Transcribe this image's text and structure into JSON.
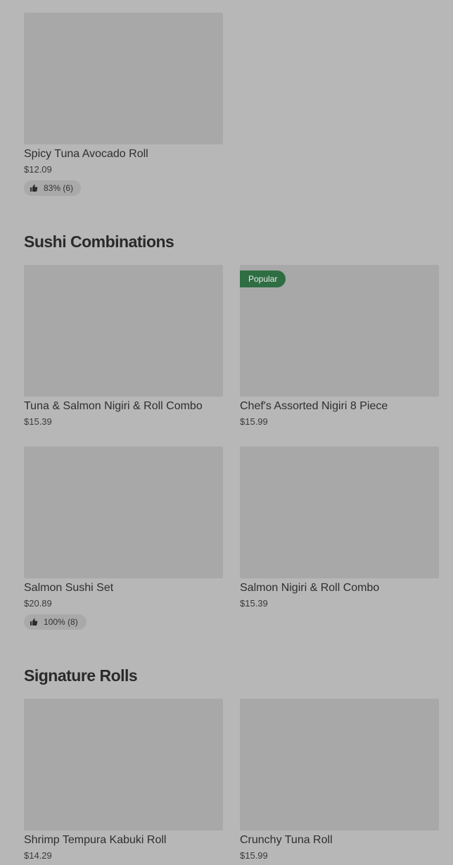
{
  "sections": [
    {
      "items": [
        {
          "name": "Spicy Tuna Avocado Roll",
          "price": "$12.09",
          "rating": "83% (6)"
        }
      ]
    },
    {
      "title": "Sushi Combinations",
      "items": [
        {
          "name": "Tuna & Salmon Nigiri & Roll Combo",
          "price": "$15.39"
        },
        {
          "name": "Chef's Assorted Nigiri 8 Piece",
          "price": "$15.99",
          "badge": "Popular"
        },
        {
          "name": "Salmon Sushi Set",
          "price": "$20.89",
          "rating": "100% (8)"
        },
        {
          "name": "Salmon Nigiri & Roll Combo",
          "price": "$15.39"
        }
      ]
    },
    {
      "title": "Signature Rolls",
      "items": [
        {
          "name": "Shrimp Tempura Kabuki Roll",
          "price": "$14.29"
        },
        {
          "name": "Crunchy Tuna Roll",
          "price": "$15.99"
        }
      ]
    }
  ],
  "icons": {
    "rating": "thumbs-up-icon"
  },
  "colors": {
    "badge_bg": "#2f6d43",
    "overlay": "#b7b7b7"
  }
}
